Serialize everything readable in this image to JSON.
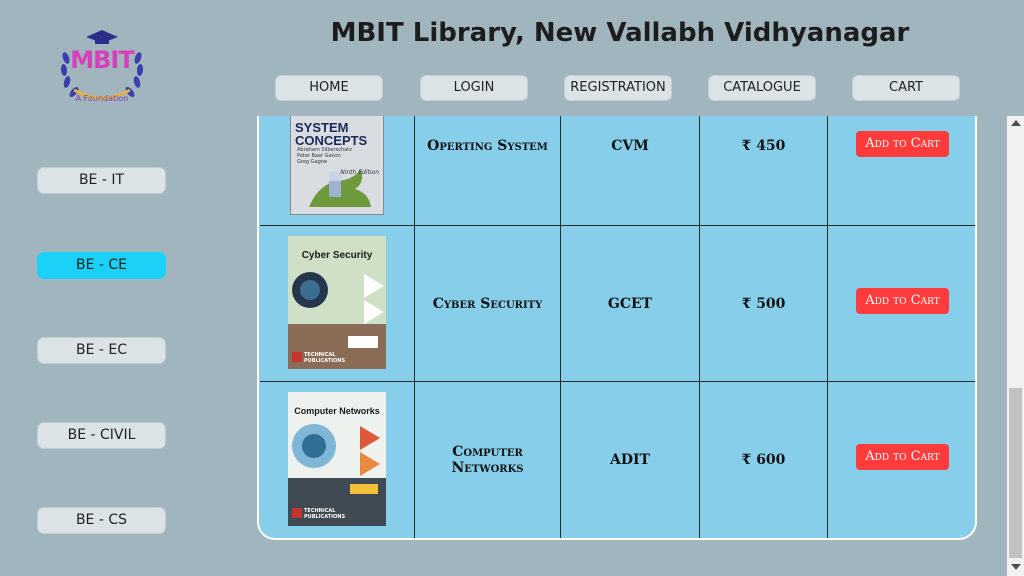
{
  "header": {
    "title": "MBIT Library, New Vallabh Vidhyanagar",
    "logo_text": "MBIT",
    "logo_subtext": "A Foundation"
  },
  "nav": [
    {
      "label": "HOME"
    },
    {
      "label": "LOGIN"
    },
    {
      "label": "REGISTRATION"
    },
    {
      "label": "CATALOGUE"
    },
    {
      "label": "CART"
    }
  ],
  "sidebar": {
    "items": [
      {
        "label": "BE - IT",
        "active": false
      },
      {
        "label": "BE - CE",
        "active": true
      },
      {
        "label": "BE - EC",
        "active": false
      },
      {
        "label": "BE - CIVIL",
        "active": false
      },
      {
        "label": "BE - CS",
        "active": false
      }
    ]
  },
  "books": [
    {
      "name": "Operting System",
      "author": "CVM",
      "price": "₹ 450",
      "button": "Add to Cart",
      "cover": {
        "title": "SYSTEM CONCEPTS",
        "authors": "Abraham Silberschatz",
        "authors2": "Peter Baer Galvin",
        "authors3": "Greg Gagne",
        "edition": "Ninth Edition"
      }
    },
    {
      "name": "Cyber Security",
      "author": "GCET",
      "price": "₹ 500",
      "button": "Add to Cart",
      "cover": {
        "title": "Cyber Security",
        "publisher": "TECHNICAL",
        "publisher2": "PUBLICATIONS"
      }
    },
    {
      "name": "Computer Networks",
      "author": "ADIT",
      "price": "₹ 600",
      "button": "Add to Cart",
      "cover": {
        "title": "Computer Networks",
        "publisher": "TECHNICAL",
        "publisher2": "PUBLICATIONS"
      }
    }
  ],
  "colors": {
    "background": "#a1b5bf",
    "panel": "#87ceeb",
    "active_side": "#1cd1f7",
    "cart_button": "#ff3b3b"
  }
}
